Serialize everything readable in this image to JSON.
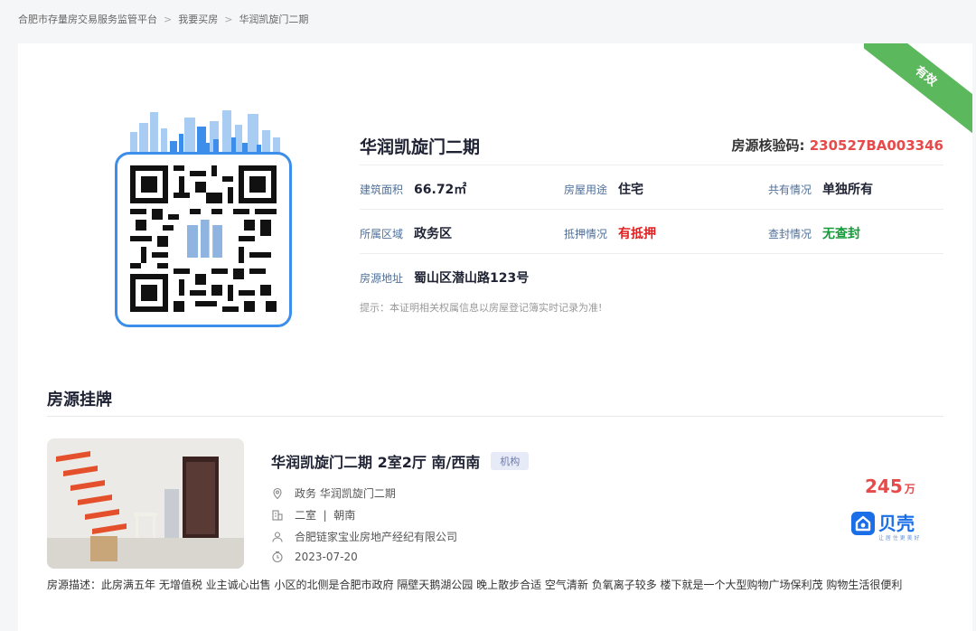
{
  "breadcrumb": {
    "items": [
      "合肥市存量房交易服务监管平台",
      "我要买房",
      "华润凯旋门二期"
    ],
    "separator": ">"
  },
  "status_ribbon": "有效",
  "property": {
    "title": "华润凯旋门二期",
    "verify_label": "房源核验码:",
    "verify_code": "230527BA003346",
    "fields": {
      "area": {
        "label": "建筑面积",
        "value": "66.72㎡"
      },
      "usage": {
        "label": "房屋用途",
        "value": "住宅"
      },
      "ownership": {
        "label": "共有情况",
        "value": "单独所有"
      },
      "district": {
        "label": "所属区域",
        "value": "政务区"
      },
      "mortgage": {
        "label": "抵押情况",
        "value": "有抵押"
      },
      "seizure": {
        "label": "查封情况",
        "value": "无查封"
      },
      "address": {
        "label": "房源地址",
        "value": "蜀山区潜山路123号"
      }
    },
    "tip": "提示：本证明相关权属信息以房屋登记簿实时记录为准!"
  },
  "listing_section": {
    "title": "房源挂牌",
    "listing": {
      "title": "华润凯旋门二期 2室2厅 南/西南",
      "tag": "机构",
      "location": "政务 华润凯旋门二期",
      "layout": "二室  |  朝南",
      "agency": "合肥链家宝业房地产经纪有限公司",
      "date": "2023-07-20",
      "price": "245",
      "price_unit": "万",
      "platform_name": "贝壳",
      "platform_sub": "让 居 住 更 美 好",
      "description": "房源描述：此房满五年 无增值税 业主诚心出售 小区的北侧是合肥市政府 隔壁天鹅湖公园 晚上散步合适 空气清新 负氧离子较多 楼下就是一个大型购物广场保利茂 购物生活很便利"
    }
  },
  "colors": {
    "accent_blue": "#3d8eea",
    "ribbon_green": "#5cb85c",
    "code_red": "#e64a4a",
    "mortgage_red": "#e02020",
    "no_seizure_green": "#179a3a",
    "beike_blue": "#1a6fe8"
  },
  "icons": [
    "location-pin-icon",
    "building-icon",
    "user-icon",
    "clock-icon",
    "qr-code-icon",
    "city-skyline-icon",
    "beike-logo-icon"
  ]
}
